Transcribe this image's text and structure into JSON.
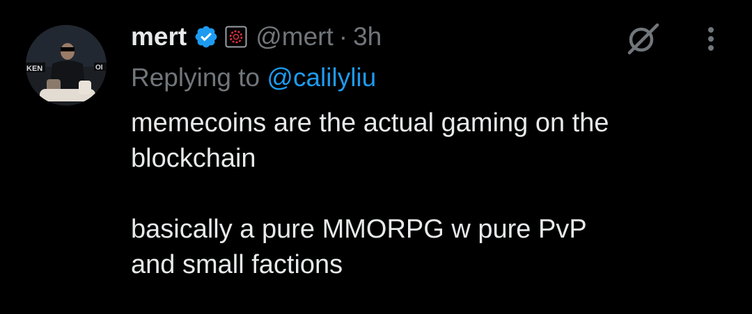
{
  "author": {
    "display_name": "mert",
    "handle": "@mert",
    "separator": "·",
    "time": "3h",
    "verified_icon": "verified-badge-icon",
    "affiliation_icon": "affiliation-badge-icon",
    "avatar_icon": "avatar-photo"
  },
  "reply": {
    "prefix": "Replying to ",
    "mention": "@calilyliu"
  },
  "content": {
    "text": "memecoins are the actual gaming on the\nblockchain\n\nbasically a pure MMORPG w pure PvP\nand small factions"
  },
  "actions": {
    "grok_icon": "grok-icon",
    "more_icon": "more-options-icon"
  },
  "colors": {
    "background": "#000000",
    "primary_text": "#e7e9ea",
    "secondary_text": "#71767b",
    "link": "#1d9bf0",
    "verified": "#1d9bf0",
    "affiliation_accent": "#e0323d"
  }
}
